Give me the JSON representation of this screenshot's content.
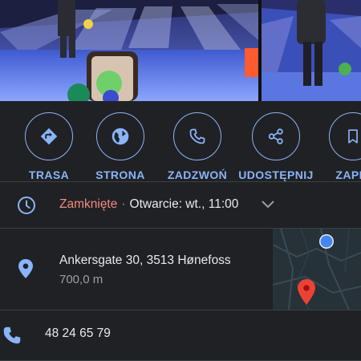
{
  "photos": {
    "items": [
      "bowling-alley-photo",
      "bowling-player-photo"
    ]
  },
  "actions": [
    {
      "label": "TRASA",
      "icon": "directions-icon"
    },
    {
      "label": "STRONA",
      "icon": "globe-icon"
    },
    {
      "label": "ZADZWOŃ",
      "icon": "phone-icon"
    },
    {
      "label": "UDOSTĘPNIJ",
      "icon": "share-icon"
    },
    {
      "label": "ZAPIS",
      "icon": "bookmark-icon"
    }
  ],
  "hours": {
    "status": "Zamknięte",
    "separator": "·",
    "opening": "Otwarcie: wt., 11:00"
  },
  "address": {
    "street": "Ankersgate 30, 3513 Hønefoss",
    "distance": "700,0 m"
  },
  "phone": {
    "number": "48 24 65 79"
  },
  "colors": {
    "background": "#202124",
    "accent": "#8ab4f8",
    "closed": "#f28b82",
    "divider": "#3c4043",
    "map_pin": "#ea4335"
  }
}
